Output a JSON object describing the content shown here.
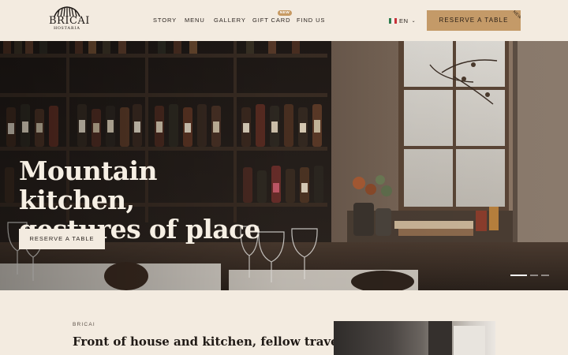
{
  "brand": {
    "name": "BRICAI",
    "sub": "HOSTARIA"
  },
  "nav": {
    "items": [
      {
        "id": "story",
        "label": "STORY"
      },
      {
        "id": "menu",
        "label": "MENU"
      },
      {
        "id": "gallery",
        "label": "GALLERY"
      },
      {
        "id": "gift-card",
        "label": "GIFT CARD"
      },
      {
        "id": "find-us",
        "label": "FIND US"
      }
    ],
    "gift_badge": "NEW"
  },
  "language": {
    "label": "EN",
    "flag_icon": "flag-icon",
    "chevron_icon": "chevron-down-icon"
  },
  "header_cta": {
    "label": "RESERVE A TABLE",
    "corner": "NEW"
  },
  "hero": {
    "title_line1": "Mountain kitchen,",
    "title_line2": "gestures of place",
    "button": "RESERVE A TABLE",
    "slides": 3,
    "active_slide": 1
  },
  "intro": {
    "kicker": "BRICAI",
    "title": "Front of house and kitchen, fellow travellers"
  },
  "colors": {
    "background": "#f3ebe0",
    "accent": "#c49a68",
    "text": "#2b2420"
  }
}
